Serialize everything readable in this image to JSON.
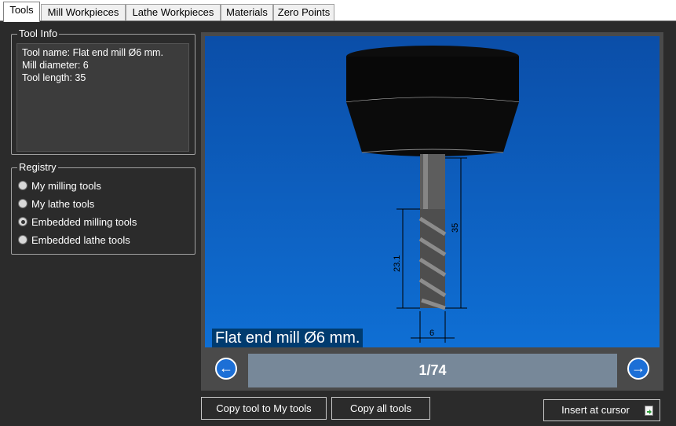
{
  "tabs": [
    {
      "label": "Tools",
      "active": true
    },
    {
      "label": "Mill Workpieces",
      "active": false
    },
    {
      "label": "Lathe Workpieces",
      "active": false
    },
    {
      "label": "Materials",
      "active": false
    },
    {
      "label": "Zero Points",
      "active": false
    }
  ],
  "tool_info": {
    "title": "Tool Info",
    "lines": [
      "Tool name: Flat end mill Ø6 mm.",
      "Mill diameter: 6",
      "Tool length: 35"
    ]
  },
  "registry": {
    "title": "Registry",
    "options": [
      {
        "label": "My milling tools",
        "checked": false
      },
      {
        "label": "My lathe tools",
        "checked": false
      },
      {
        "label": "Embedded milling tools",
        "checked": true
      },
      {
        "label": "Embedded lathe tools",
        "checked": false
      }
    ]
  },
  "preview": {
    "caption": "Flat end mill Ø6 mm.",
    "dim_total_length": "35",
    "dim_flute_length": "23.1",
    "dim_diameter": "6",
    "counter": "1/74",
    "prev_icon": "arrow-left-icon",
    "next_icon": "arrow-right-icon"
  },
  "buttons": {
    "copy_tool": "Copy tool to My tools",
    "copy_all": "Copy all tools",
    "insert": "Insert at cursor",
    "insert_icon": "insert-document-icon"
  },
  "colors": {
    "background": "#2b2b2b",
    "viewport_top": "#0b4ea8",
    "counter_bar": "#778899",
    "caption_bg": "#003b6f"
  }
}
